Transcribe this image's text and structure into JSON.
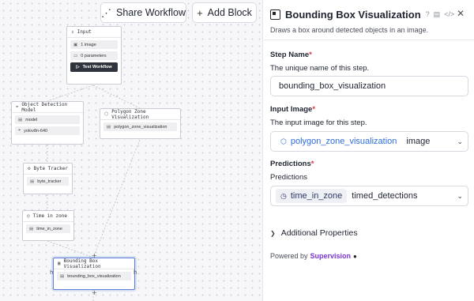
{
  "toolbar": {
    "share_label": "Share Workflow",
    "share_icon": "share-icon",
    "add_label": "Add Block",
    "add_icon": "plus-icon"
  },
  "nodes": {
    "input": {
      "title": "Input",
      "rows": [
        "1 image",
        "0 parameters"
      ],
      "button": "Test Workflow"
    },
    "object_detection": {
      "title": "Object Detection Model",
      "rows": [
        "model",
        "yolov8n-640"
      ]
    },
    "polygon_zone": {
      "title": "Polygon Zone Visualization",
      "rows": [
        "polygon_zone_visualization"
      ]
    },
    "byte_tracker": {
      "title": "Byte Tracker",
      "rows": [
        "byte_tracker"
      ]
    },
    "time_in_zone": {
      "title": "Time in zone",
      "rows": [
        "time_in_zone"
      ]
    },
    "bounding_box": {
      "title": "Bounding Box Visualization",
      "rows": [
        "bounding_box_visualization"
      ]
    }
  },
  "panel": {
    "title": "Bounding Box Visualization",
    "description": "Draws a box around detected objects in an image.",
    "step_name": {
      "label": "Step Name",
      "required_mark": "*",
      "help": "The unique name of this step.",
      "value": "bounding_box_visualization"
    },
    "input_image": {
      "label": "Input Image",
      "required_mark": "*",
      "help": "The input image for this step.",
      "chip": "polygon_zone_visualization",
      "value": "image"
    },
    "predictions": {
      "label": "Predictions",
      "required_mark": "*",
      "help": "Predictions",
      "chip": "time_in_zone",
      "value": "timed_detections"
    },
    "advanced": "Additional Properties",
    "powered_by": "Powered by",
    "powered_link": "Supervision"
  },
  "colors": {
    "accent_blue": "#2d6dd8",
    "required_red": "#e0313f",
    "link_purple": "#7a35d6",
    "selected_border": "#5b7fd6"
  }
}
